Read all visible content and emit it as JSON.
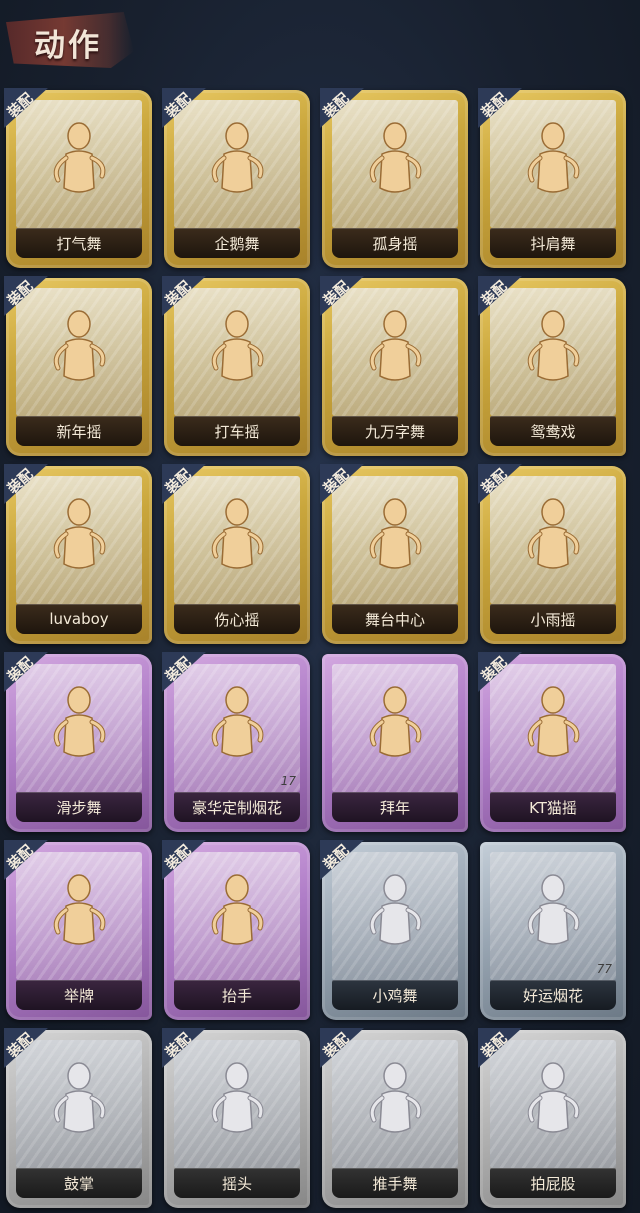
{
  "header": {
    "title": "动作"
  },
  "badge_label": "装配",
  "cards": [
    {
      "name": "打气舞",
      "tier": "gold",
      "equipped": true
    },
    {
      "name": "企鹅舞",
      "tier": "gold",
      "equipped": true
    },
    {
      "name": "孤身摇",
      "tier": "gold",
      "equipped": true
    },
    {
      "name": "抖肩舞",
      "tier": "gold",
      "equipped": true
    },
    {
      "name": "新年摇",
      "tier": "gold",
      "equipped": true
    },
    {
      "name": "打车摇",
      "tier": "gold",
      "equipped": true
    },
    {
      "name": "九万字舞",
      "tier": "gold",
      "equipped": true
    },
    {
      "name": "鸳鸯戏",
      "tier": "gold",
      "equipped": true
    },
    {
      "name": "luvaboy",
      "tier": "gold",
      "equipped": true
    },
    {
      "name": "伤心摇",
      "tier": "gold",
      "equipped": true
    },
    {
      "name": "舞台中心",
      "tier": "gold",
      "equipped": true
    },
    {
      "name": "小雨摇",
      "tier": "gold",
      "equipped": true
    },
    {
      "name": "滑步舞",
      "tier": "purple",
      "equipped": true
    },
    {
      "name": "豪华定制烟花",
      "tier": "purple",
      "equipped": true,
      "count": "17"
    },
    {
      "name": "拜年",
      "tier": "purple",
      "equipped": false
    },
    {
      "name": "KT猫摇",
      "tier": "purple",
      "equipped": true
    },
    {
      "name": "举牌",
      "tier": "purple",
      "equipped": true
    },
    {
      "name": "抬手",
      "tier": "purple",
      "equipped": true
    },
    {
      "name": "小鸡舞",
      "tier": "blue",
      "equipped": true
    },
    {
      "name": "好运烟花",
      "tier": "blue",
      "equipped": false,
      "count": "77"
    },
    {
      "name": "鼓掌",
      "tier": "gray",
      "equipped": true
    },
    {
      "name": "摇头",
      "tier": "gray",
      "equipped": true
    },
    {
      "name": "推手舞",
      "tier": "gray",
      "equipped": true
    },
    {
      "name": "拍屁股",
      "tier": "gray",
      "equipped": true
    }
  ],
  "colors": {
    "gold": "#c9a63c",
    "purple": "#b07ec8",
    "blue": "#98a5b2",
    "gray": "#b2b2b2",
    "badge": "#2d3a57"
  },
  "icons": {
    "figure_gold": "dancer-silhouette-icon-gold",
    "figure_faded": "dancer-silhouette-icon-faded"
  }
}
